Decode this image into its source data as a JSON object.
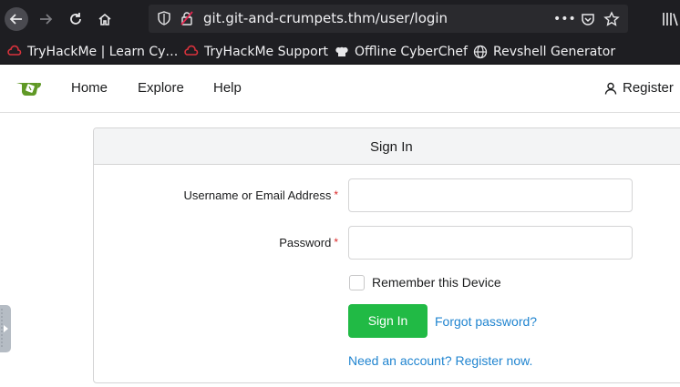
{
  "browser": {
    "url": "git.git-and-crumpets.thm/user/login",
    "bookmarks": [
      {
        "label": "TryHackMe | Learn Cy…",
        "icon": "tryhackme-icon"
      },
      {
        "label": "TryHackMe Support",
        "icon": "tryhackme-icon"
      },
      {
        "label": "Offline CyberChef",
        "icon": "chef-hat-icon"
      },
      {
        "label": "Revshell Generator",
        "icon": "globe-icon"
      }
    ]
  },
  "site_nav": {
    "links": [
      "Home",
      "Explore",
      "Help"
    ],
    "register": "Register"
  },
  "form": {
    "title": "Sign In",
    "username_label": "Username or Email Address",
    "password_label": "Password",
    "required_mark": "*",
    "remember_label": "Remember this Device",
    "signin_button": "Sign In",
    "forgot_link": "Forgot password?",
    "register_link": "Need an account? Register now."
  },
  "colors": {
    "brand_green": "#609926",
    "button_green": "#21ba45",
    "link_blue": "#2185d0",
    "required_red": "#db2828",
    "chrome_dark": "#1e1e22"
  }
}
